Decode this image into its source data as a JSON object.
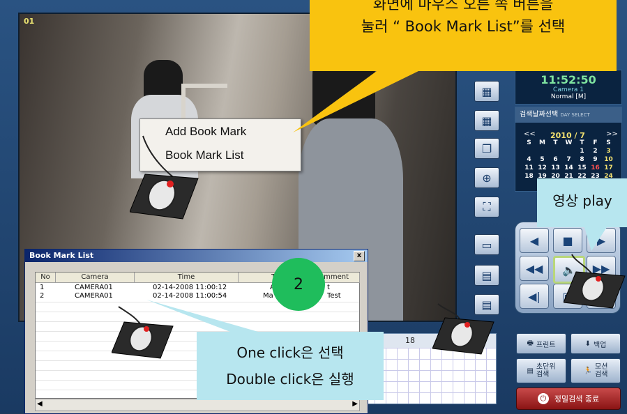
{
  "video": {
    "channel_id": "01"
  },
  "clock": {
    "time": "11:52:50",
    "camera": "Camera 1",
    "mode": "Normal [M]"
  },
  "calendar": {
    "header": "검색날짜선택",
    "header_sub": "DAY SELECT",
    "month": "2010 / 7",
    "prev": "<<",
    "next": ">>",
    "weekdays": [
      "S",
      "M",
      "T",
      "W",
      "T",
      "F",
      "S"
    ],
    "rows": [
      [
        "",
        "",
        "",
        "",
        "1",
        "2",
        "3"
      ],
      [
        "4",
        "5",
        "6",
        "7",
        "8",
        "9",
        "10"
      ],
      [
        "11",
        "12",
        "13",
        "14",
        "15",
        "16",
        "17"
      ],
      [
        "18",
        "19",
        "20",
        "21",
        "22",
        "23",
        "24"
      ]
    ]
  },
  "controls": {
    "prev_icon": "rewind-icon",
    "stop_icon": "stop-icon",
    "play_icon": "play-icon"
  },
  "actions": {
    "print": "프린트",
    "backup": "백업",
    "second_search_1": "초단위",
    "second_search_2": "검색",
    "motion_search_1": "모션",
    "motion_search_2": "검색",
    "end_search": "정밀검색 종료"
  },
  "timeline": {
    "hour": "18"
  },
  "context_menu": {
    "items": [
      "Add Book Mark",
      "Book Mark List"
    ]
  },
  "bookmark_window": {
    "title": "Book Mark List",
    "close": "x",
    "columns": [
      "No",
      "Camera",
      "Time",
      "T",
      "omment"
    ],
    "rows": [
      {
        "no": "1",
        "camera": "CAMERA01",
        "time": "02-14-2008 11:00:12",
        "type": "A",
        "comment": "t"
      },
      {
        "no": "2",
        "camera": "CAMERA01",
        "time": "02-14-2008 11:00:54",
        "type": "Ma",
        "comment": "Test"
      }
    ]
  },
  "callouts": {
    "top_line1": "화면에 마우스 오른 쪽 버튼을",
    "top_line2": "눌러  “ Book Mark List”를 선택",
    "play": "영상 play",
    "badge": "2",
    "click_line1": "One click은 선택",
    "click_line2": "Double click은 실행"
  },
  "colors": {
    "callout_top": "#f9c30f",
    "callout_light": "#b7e6ef",
    "badge": "#1fbd5c"
  }
}
